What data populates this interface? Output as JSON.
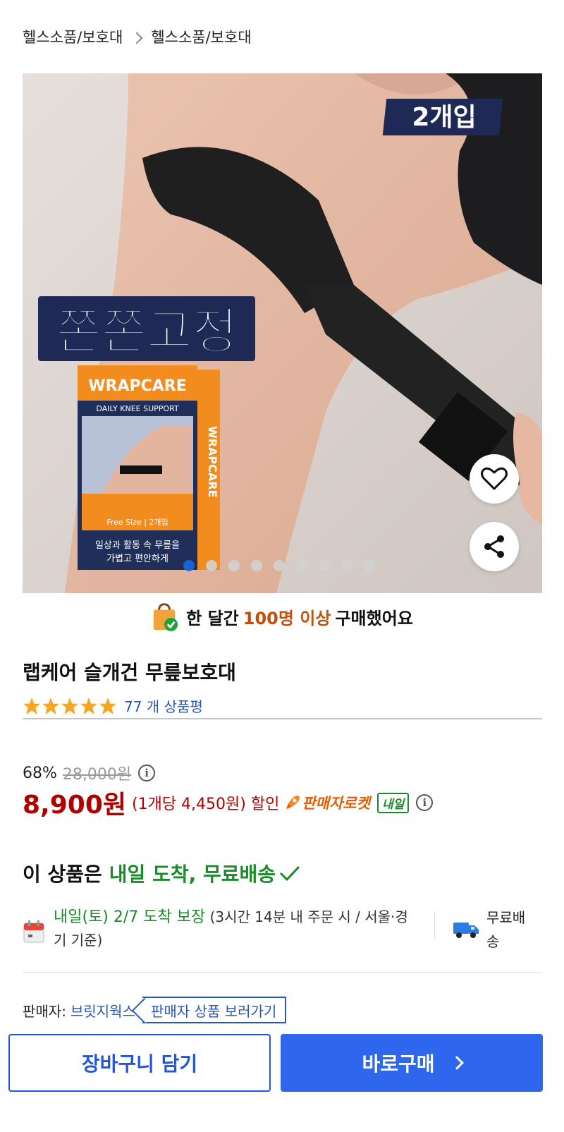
{
  "breadcrumb": {
    "items": [
      "헬스소품/보호대",
      "헬스소품/보호대"
    ]
  },
  "gallery": {
    "badge_count": "2개입",
    "slogan": "쫀쫀고정",
    "box_brand": "WRAPCARE",
    "box_subtitle": "DAILY KNEE SUPPORT",
    "box_size": "Free Size | 2개입",
    "box_caption_line1": "일상과 활동 속 무릎을",
    "box_caption_line2": "가볍고 편안하게",
    "box_side_brand": "WRAPCARE",
    "slide_count": 9,
    "active_slide": 0
  },
  "purchase_banner": {
    "prefix": "한 달간",
    "highlight": "100명 이상",
    "suffix": "구매했어요"
  },
  "product": {
    "title": "랩케어 슬개건 무릎보호대",
    "rating": 5,
    "review_count_label": "77 개 상품평"
  },
  "price": {
    "discount": "68%",
    "original": "28,000원",
    "sale": "8,900원",
    "unit": "(1개당 4,450원) 할인",
    "rocket_label": "판매자로켓",
    "tomorrow_badge": "내일"
  },
  "delivery": {
    "headline_prefix": "이 상품은",
    "headline_highlight": "내일 도착, 무료배송",
    "arrival": "내일(토) 2/7 도착 보장",
    "arrival_detail": "(3시간 14분 내 주문 시 / 서울·경기 기준)",
    "free_shipping": "무료배송"
  },
  "seller": {
    "label": "판매자:",
    "name": "브릿지웍스",
    "link": "판매자 상품 보러가기"
  },
  "actions": {
    "cart": "장바구니 담기",
    "buy": "바로구매"
  },
  "colors": {
    "accent_blue": "#2f66ee",
    "price_red": "#ae0000",
    "delivery_green": "#1b8a2a",
    "star_orange": "#f5a623"
  }
}
